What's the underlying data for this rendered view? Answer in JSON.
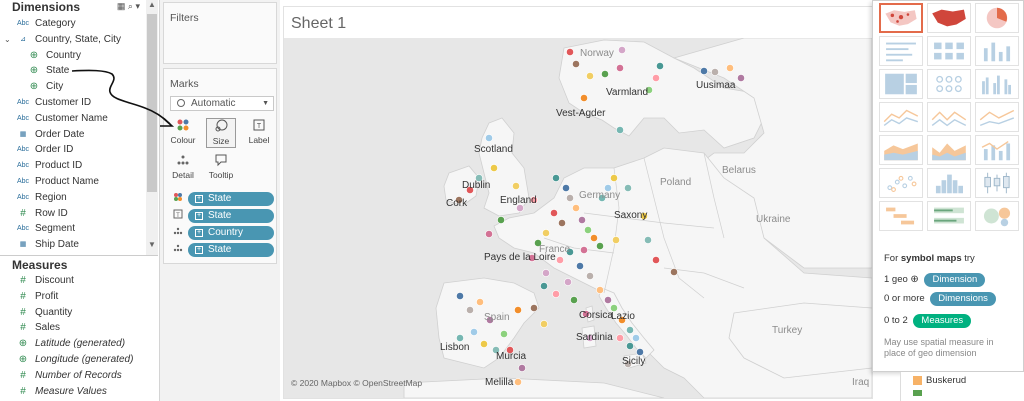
{
  "dimensions": {
    "title": "Dimensions",
    "fields": [
      {
        "type": "Abc",
        "name": "Category"
      },
      {
        "type": "hier",
        "name": "Country, State, City"
      },
      {
        "type": "geo",
        "name": "Country"
      },
      {
        "type": "geo",
        "name": "State"
      },
      {
        "type": "geo",
        "name": "City"
      },
      {
        "type": "Abc",
        "name": "Customer ID"
      },
      {
        "type": "Abc",
        "name": "Customer Name"
      },
      {
        "type": "date",
        "name": "Order Date"
      },
      {
        "type": "Abc",
        "name": "Order ID"
      },
      {
        "type": "Abc",
        "name": "Product ID"
      },
      {
        "type": "Abc",
        "name": "Product Name"
      },
      {
        "type": "Abc",
        "name": "Region"
      },
      {
        "type": "num",
        "name": "Row ID"
      },
      {
        "type": "Abc",
        "name": "Segment"
      },
      {
        "type": "date",
        "name": "Ship Date"
      }
    ]
  },
  "measures": {
    "title": "Measures",
    "fields": [
      {
        "type": "num",
        "name": "Discount"
      },
      {
        "type": "num",
        "name": "Profit"
      },
      {
        "type": "num",
        "name": "Quantity"
      },
      {
        "type": "num",
        "name": "Sales"
      },
      {
        "type": "geo",
        "name": "Latitude (generated)"
      },
      {
        "type": "geo",
        "name": "Longitude (generated)"
      },
      {
        "type": "num",
        "name": "Number of Records"
      },
      {
        "type": "num",
        "name": "Measure Values"
      }
    ]
  },
  "filters": {
    "title": "Filters"
  },
  "marks": {
    "title": "Marks",
    "type": "Automatic",
    "buttons": [
      "Colour",
      "Size",
      "Label",
      "Detail",
      "Tooltip"
    ],
    "pills": [
      {
        "icon": "colour",
        "label": "State"
      },
      {
        "icon": "label",
        "label": "State"
      },
      {
        "icon": "detail",
        "label": "Country"
      },
      {
        "icon": "detail",
        "label": "State"
      }
    ]
  },
  "sheet": {
    "title": "Sheet 1"
  },
  "map": {
    "credit": "© 2020 Mapbox © OpenStreetMap",
    "labels": [
      "Norway",
      "Uusimaa",
      "Varmland",
      "Vest-Agder",
      "Scotland",
      "Dublin",
      "Cork",
      "England",
      "Germany",
      "Saxony",
      "Poland",
      "Belarus",
      "Ukraine",
      "France",
      "Pays de la Loire",
      "Spain",
      "Corsica",
      "Lazio",
      "Sardinia",
      "Lisbon",
      "Murcia",
      "Sicily",
      "Melilla",
      "Turkey",
      "Iraq"
    ],
    "point_colors": [
      "#e15759",
      "#f28e2b",
      "#4e79a7",
      "#59a14f",
      "#edc948",
      "#b07aa1",
      "#ff9da7",
      "#9c755f",
      "#76b7b2",
      "#bab0ac",
      "#d37295",
      "#86bcb6",
      "#8cd17d",
      "#499894",
      "#f1ce63",
      "#a0cbe8",
      "#ffbe7d",
      "#d4a6c8"
    ]
  },
  "showme": {
    "help_lead": "For",
    "help_bold": "symbol maps",
    "help_tail": "try",
    "req1_prefix": "1 geo",
    "req1_chip": "Dimension",
    "req2_prefix": "0 or more",
    "req2_chip": "Dimensions",
    "req3_prefix": "0 to 2",
    "req3_chip": "Measures",
    "note": "May use spatial measure in place of geo dimension",
    "chip_color_dim": "#4996b2",
    "chip_color_meas": "#00b180",
    "selected_border": "#e36b4a"
  },
  "legend": {
    "items": [
      {
        "label": "Buskerud",
        "color": "#f7b267"
      }
    ]
  }
}
